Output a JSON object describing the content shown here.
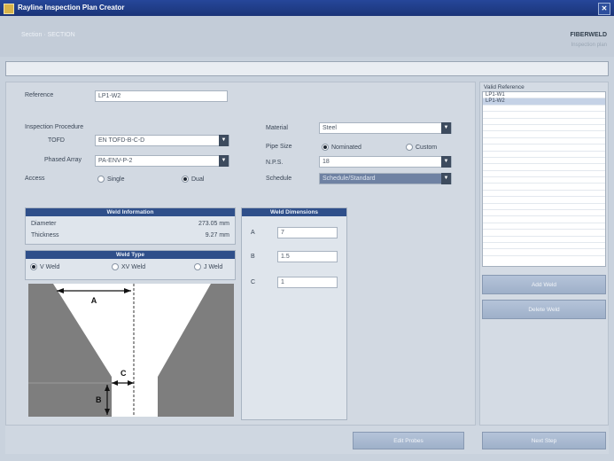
{
  "window": {
    "title": "Rayline Inspection Plan Creator",
    "close_glyph": "✕"
  },
  "header": {
    "left_text": "Section · SECTION",
    "right_title": "FIBERWELD",
    "right_sub": "Inspection plan"
  },
  "form": {
    "reference_label": "Reference",
    "reference_value": "LP1-W2",
    "inspection_procedure_label": "Inspection Procedure",
    "tofd_label": "TOFD",
    "tofd_value": "EN TOFD-B-C-D",
    "phased_array_label": "Phased Array",
    "phased_array_value": "PA-ENV-P-2",
    "access_label": "Access",
    "access_options": [
      "Single",
      "Dual"
    ],
    "access_selected": "Dual",
    "material_label": "Material",
    "material_value": "Steel",
    "pipe_size_label": "Pipe Size",
    "pipe_size_options": [
      "Nominated",
      "Custom"
    ],
    "pipe_size_selected": "Nominated",
    "nps_label": "N.P.S.",
    "nps_value": "18",
    "schedule_label": "Schedule",
    "schedule_value": "Schedule/Standard"
  },
  "weld_information": {
    "title": "Weld Information",
    "diameter_label": "Diameter",
    "diameter_value": "273.05 mm",
    "thickness_label": "Thickness",
    "thickness_value": "9.27 mm"
  },
  "weld_type": {
    "title": "Weld Type",
    "options": [
      "V Weld",
      "XV Weld",
      "J Weld"
    ],
    "selected": "V Weld"
  },
  "weld_dimensions": {
    "title": "Weld Dimensions",
    "fields": [
      {
        "label": "A",
        "value": "7"
      },
      {
        "label": "B",
        "value": "1.5"
      },
      {
        "label": "C",
        "value": "1"
      }
    ]
  },
  "diagram": {
    "labels": [
      "A",
      "B",
      "C"
    ]
  },
  "valid_reference": {
    "title": "Valid Reference",
    "items": [
      "LP1-W1",
      "LP1-W2"
    ],
    "selected": "LP1-W2"
  },
  "buttons": {
    "add_weld": "Add Weld",
    "delete_weld": "Delete Weld",
    "edit_probes": "Edit Probes",
    "next": "Next Step"
  },
  "colors": {
    "titlebar": "#1b3477",
    "panel_title": "#2f4f8a",
    "button": "#a9b9cf"
  }
}
